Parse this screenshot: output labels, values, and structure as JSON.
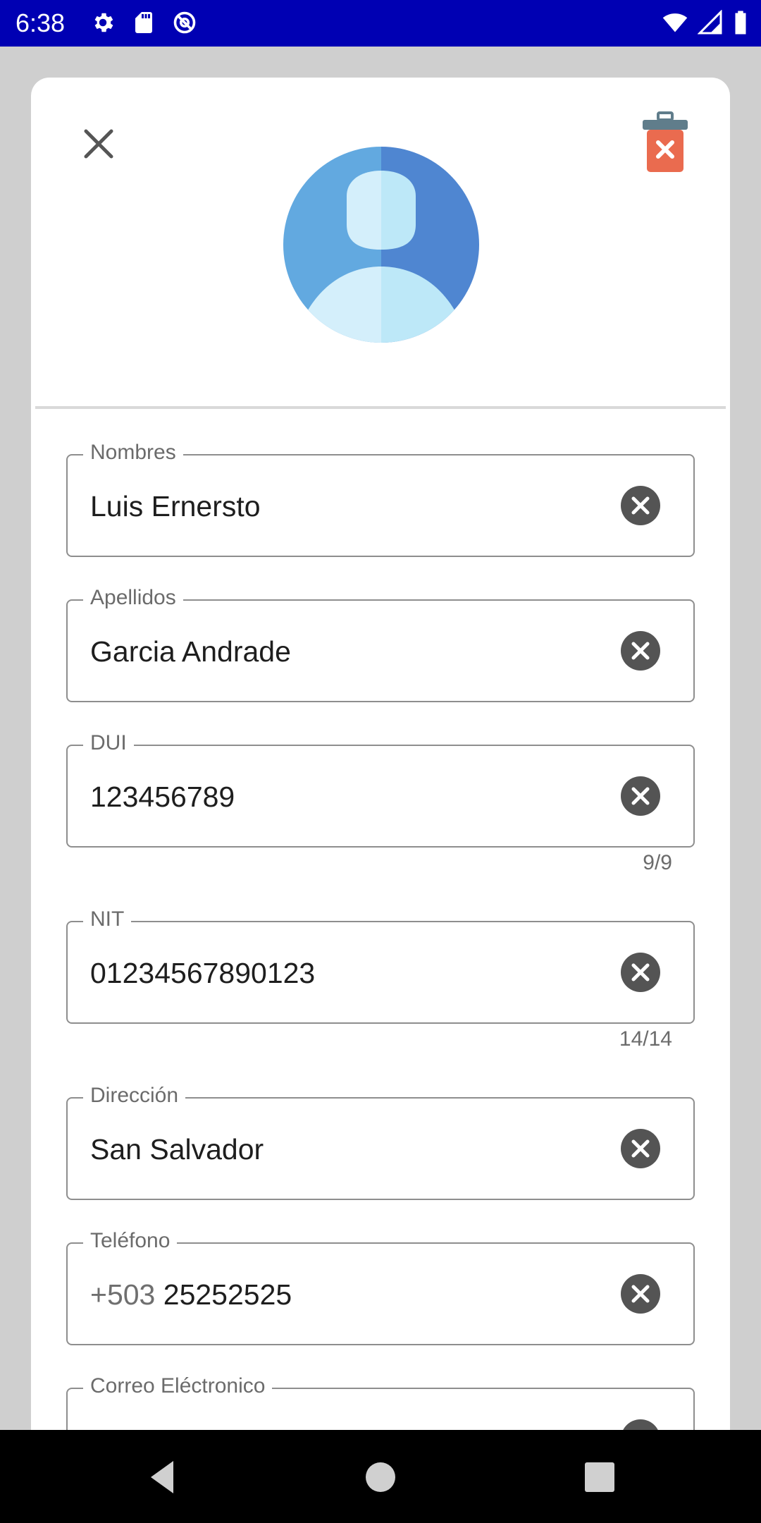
{
  "status_bar": {
    "time": "6:38",
    "left_icons": [
      "gear-icon",
      "sd-card-icon",
      "at-sign-icon"
    ],
    "right_icons": [
      "wifi-icon",
      "signal-icon",
      "battery-icon"
    ],
    "background": "#0000b3"
  },
  "header": {
    "close_icon": "close-icon",
    "delete_icon": "trash-delete-icon",
    "avatar_icon": "user-avatar-icon"
  },
  "form": {
    "fields": [
      {
        "label": "Nombres",
        "prefix": "",
        "value": "Luis Ernersto",
        "counter": ""
      },
      {
        "label": "Apellidos",
        "prefix": "",
        "value": "Garcia Andrade",
        "counter": ""
      },
      {
        "label": "DUI",
        "prefix": "",
        "value": "123456789",
        "counter": "9/9"
      },
      {
        "label": "NIT",
        "prefix": "",
        "value": "01234567890123",
        "counter": "14/14"
      },
      {
        "label": "Dirección",
        "prefix": "",
        "value": "San Salvador",
        "counter": ""
      },
      {
        "label": "Teléfono",
        "prefix": "+503",
        "value": "25252525",
        "counter": ""
      },
      {
        "label": "Correo Eléctronico",
        "prefix": "",
        "value": "",
        "counter": ""
      }
    ]
  },
  "nav_bar": {
    "icons": [
      "back-icon",
      "home-icon",
      "recents-icon"
    ]
  },
  "colors": {
    "avatar_dark": "#4f86d1",
    "avatar_light": "#62a9e0",
    "delete_red": "#ea6b4f",
    "clear_icon": "#545454"
  }
}
